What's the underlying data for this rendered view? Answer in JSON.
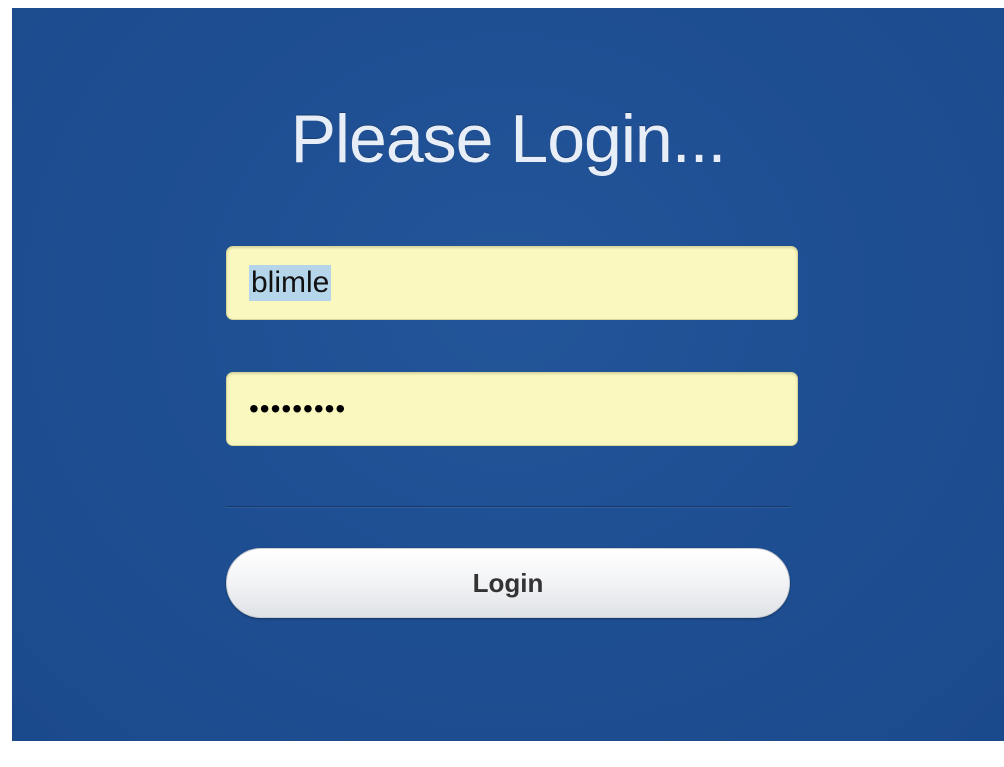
{
  "login": {
    "title": "Please Login...",
    "username_value": "blimle",
    "password_masked": "•••••••••",
    "button_label": "Login"
  },
  "colors": {
    "background": "#1f4f93",
    "input_background": "#fbf8bf",
    "selection_highlight": "#b5d5ea",
    "button_background": "#f2f3f5"
  }
}
